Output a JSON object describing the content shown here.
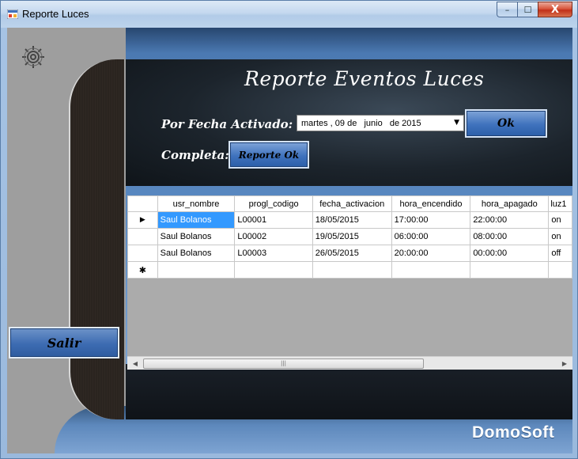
{
  "window": {
    "title": "Reporte Luces",
    "controls": {
      "minimize": "–",
      "maximize": "☐",
      "close": "X"
    }
  },
  "form": {
    "title": "Reporte Eventos Luces",
    "fecha_label": "Por Fecha Activado:",
    "completa_label": "Completa:",
    "date_value": "martes , 09 de   junio   de 2015",
    "ok_button": "Ok",
    "reporte_button": "Reporte Ok",
    "salir_button": "Salir"
  },
  "grid": {
    "columns": [
      "usr_nombre",
      "progl_codigo",
      "fecha_activacion",
      "hora_encendido",
      "hora_apagado",
      "luz1"
    ],
    "rows": [
      [
        "Saul Bolanos",
        "L00001",
        "18/05/2015",
        "17:00:00",
        "22:00:00",
        "on"
      ],
      [
        "Saul Bolanos",
        "L00002",
        "19/05/2015",
        "06:00:00",
        "08:00:00",
        "on"
      ],
      [
        "Saul Bolanos",
        "L00003",
        "26/05/2015",
        "20:00:00",
        "00:00:00",
        "off"
      ]
    ],
    "current_row_marker": "▶",
    "new_row_marker": "✱",
    "scroll_thumb_grip": "|||"
  },
  "brand": "DomoSoft",
  "icons": {
    "app": "app-icon",
    "settings": "gear-icon"
  },
  "colors": {
    "selected_cell": "#3399ff",
    "button_blue": "#3f72bd",
    "panel_dark": "#1c242c"
  }
}
